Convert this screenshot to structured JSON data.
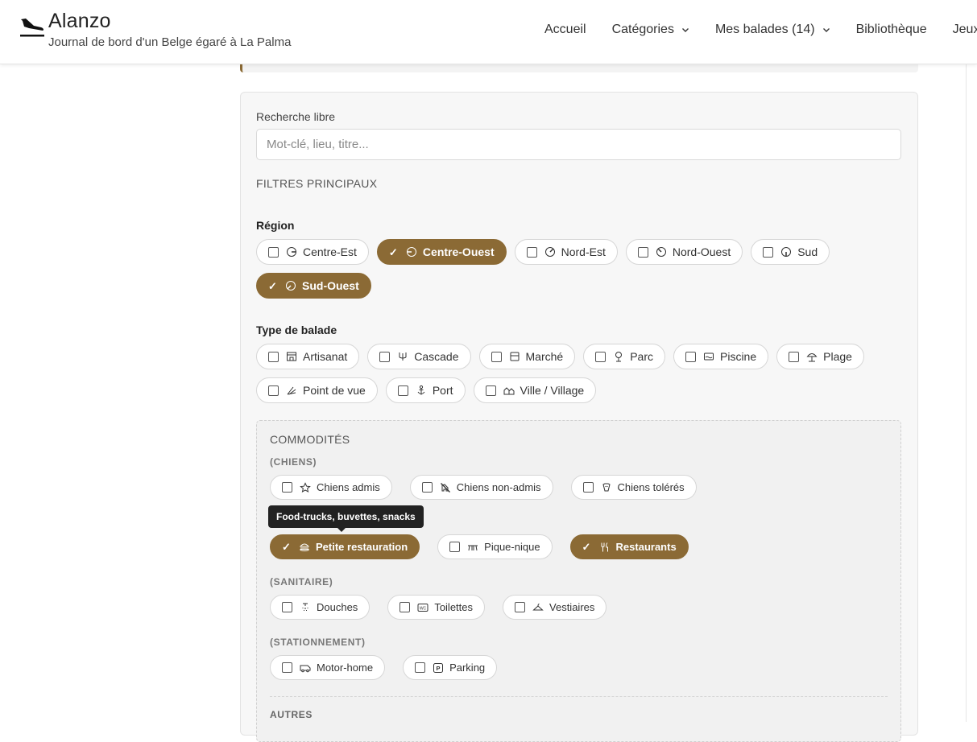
{
  "site": {
    "title": "Alanzo",
    "tagline": "Journal de bord d'un Belge égaré à La Palma"
  },
  "nav": {
    "items": [
      {
        "label": "Accueil",
        "dropdown": false
      },
      {
        "label": "Catégories",
        "dropdown": true
      },
      {
        "label": "Mes balades (14)",
        "dropdown": true
      },
      {
        "label": "Bibliothèque",
        "dropdown": false
      },
      {
        "label": "Jeux",
        "dropdown": false
      }
    ]
  },
  "search": {
    "label": "Recherche libre",
    "placeholder": "Mot-clé, lieu, titre...",
    "value": ""
  },
  "filters": {
    "section_title": "FILTRES PRINCIPAUX",
    "region": {
      "label": "Région",
      "options": [
        {
          "label": "Centre-Est",
          "selected": false,
          "icon": "compass-east-icon"
        },
        {
          "label": "Centre-Ouest",
          "selected": true,
          "icon": "compass-west-icon"
        },
        {
          "label": "Nord-Est",
          "selected": false,
          "icon": "compass-northeast-icon"
        },
        {
          "label": "Nord-Ouest",
          "selected": false,
          "icon": "compass-northwest-icon"
        },
        {
          "label": "Sud",
          "selected": false,
          "icon": "compass-south-icon"
        },
        {
          "label": "Sud-Ouest",
          "selected": true,
          "icon": "compass-southwest-icon"
        }
      ]
    },
    "type": {
      "label": "Type de balade",
      "options": [
        {
          "label": "Artisanat",
          "selected": false,
          "icon": "shop-icon"
        },
        {
          "label": "Cascade",
          "selected": false,
          "icon": "waterfall-icon"
        },
        {
          "label": "Marché",
          "selected": false,
          "icon": "market-stall-icon"
        },
        {
          "label": "Parc",
          "selected": false,
          "icon": "tree-icon"
        },
        {
          "label": "Piscine",
          "selected": false,
          "icon": "pool-icon"
        },
        {
          "label": "Plage",
          "selected": false,
          "icon": "umbrella-beach-icon"
        },
        {
          "label": "Point de vue",
          "selected": false,
          "icon": "binoculars-icon"
        },
        {
          "label": "Port",
          "selected": false,
          "icon": "anchor-icon"
        },
        {
          "label": "Ville / Village",
          "selected": false,
          "icon": "houses-icon"
        }
      ]
    }
  },
  "commodites": {
    "title": "COMMODITÉS",
    "groups": [
      {
        "label": "(CHIENS)",
        "options": [
          {
            "label": "Chiens admis",
            "selected": false,
            "icon": "star-icon"
          },
          {
            "label": "Chiens non-admis",
            "selected": false,
            "icon": "no-dog-icon"
          },
          {
            "label": "Chiens tolérés",
            "selected": false,
            "icon": "dog-icon"
          }
        ]
      },
      {
        "label": "",
        "options": [
          {
            "label": "Petite restauration",
            "selected": true,
            "icon": "burger-icon"
          },
          {
            "label": "Pique-nique",
            "selected": false,
            "icon": "picnic-table-icon"
          },
          {
            "label": "Restaurants",
            "selected": true,
            "icon": "fork-knife-icon"
          }
        ]
      },
      {
        "label": "(SANITAIRE)",
        "options": [
          {
            "label": "Douches",
            "selected": false,
            "icon": "shower-icon"
          },
          {
            "label": "Toilettes",
            "selected": false,
            "icon": "wc-icon"
          },
          {
            "label": "Vestiaires",
            "selected": false,
            "icon": "hanger-icon"
          }
        ]
      },
      {
        "label": "(STATIONNEMENT)",
        "options": [
          {
            "label": "Motor-home",
            "selected": false,
            "icon": "camper-icon"
          },
          {
            "label": "Parking",
            "selected": false,
            "icon": "parking-icon"
          }
        ]
      }
    ],
    "tooltip": "Food-trucks, buvettes, snacks",
    "next_section": "AUTRES"
  },
  "colors": {
    "accent": "#8b6a35",
    "panel_bg": "#f7f7f7",
    "commod_bg": "#f1f1f1",
    "tooltip_bg": "#222222"
  }
}
